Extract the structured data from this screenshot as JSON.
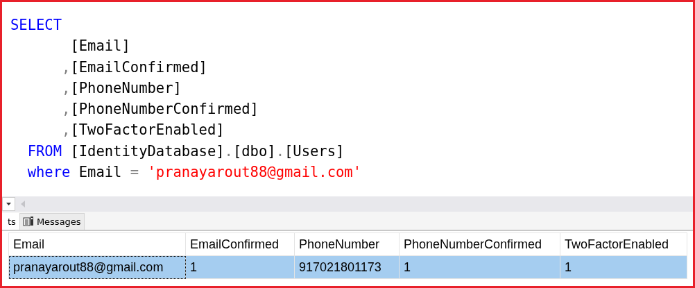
{
  "editor": {
    "lines": [
      [
        {
          "kind": "keyword",
          "text": "SELECT"
        }
      ],
      [
        {
          "kind": "plain",
          "text": "       [Email]"
        }
      ],
      [
        {
          "kind": "punct",
          "text": "      ,"
        },
        {
          "kind": "plain",
          "text": "[EmailConfirmed]"
        }
      ],
      [
        {
          "kind": "punct",
          "text": "      ,"
        },
        {
          "kind": "plain",
          "text": "[PhoneNumber]"
        }
      ],
      [
        {
          "kind": "punct",
          "text": "      ,"
        },
        {
          "kind": "plain",
          "text": "[PhoneNumberConfirmed]"
        }
      ],
      [
        {
          "kind": "punct",
          "text": "      ,"
        },
        {
          "kind": "plain",
          "text": "[TwoFactorEnabled]"
        }
      ],
      [
        {
          "kind": "keyword",
          "text": "  FROM"
        },
        {
          "kind": "plain",
          "text": " [IdentityDatabase]"
        },
        {
          "kind": "punct",
          "text": "."
        },
        {
          "kind": "plain",
          "text": "[dbo]"
        },
        {
          "kind": "punct",
          "text": "."
        },
        {
          "kind": "plain",
          "text": "[Users]"
        }
      ],
      [
        {
          "kind": "keyword",
          "text": "  where"
        },
        {
          "kind": "plain",
          "text": " Email "
        },
        {
          "kind": "punct",
          "text": "="
        },
        {
          "kind": "string",
          "text": " 'pranayarout88@gmail.com'"
        }
      ]
    ]
  },
  "tabs": [
    {
      "kind": "text",
      "label": "ts",
      "selected": true
    },
    {
      "kind": "document",
      "label": "Messages",
      "selected": false
    }
  ],
  "table": {
    "columns": [
      "Email",
      "EmailConfirmed",
      "PhoneNumber",
      "PhoneNumberConfirmed",
      "TwoFactorEnabled"
    ],
    "rows": [
      {
        "selected": true,
        "cells": [
          "pranayarout88@gmail.com",
          "1",
          "917021801173",
          "1",
          "1"
        ]
      }
    ]
  }
}
